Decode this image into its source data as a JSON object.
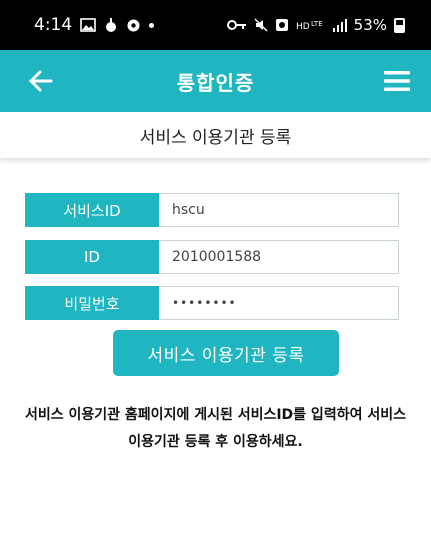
{
  "status_bar": {
    "time": "4:14",
    "battery": "53%",
    "network": "LTE"
  },
  "app_bar": {
    "title": "통합인증",
    "back_icon": "arrow-left-icon",
    "menu_icon": "hamburger-menu-icon"
  },
  "page": {
    "subtitle": "서비스 이용기관 등록"
  },
  "form": {
    "service_id": {
      "label": "서비스ID",
      "value": "hscu"
    },
    "id": {
      "label": "ID",
      "value": "2010001588"
    },
    "password": {
      "label": "비밀번호",
      "value": "••••••••"
    }
  },
  "register_button": {
    "label": "서비스 이용기관 등록"
  },
  "notice": "서비스 이용기관 홈페이지에 게시된 서비스ID를 입력하여 서비스 이용기관 등록 후 이용하세요.",
  "colors": {
    "accent": "#1fb6c1",
    "status_bar": "#000000"
  }
}
